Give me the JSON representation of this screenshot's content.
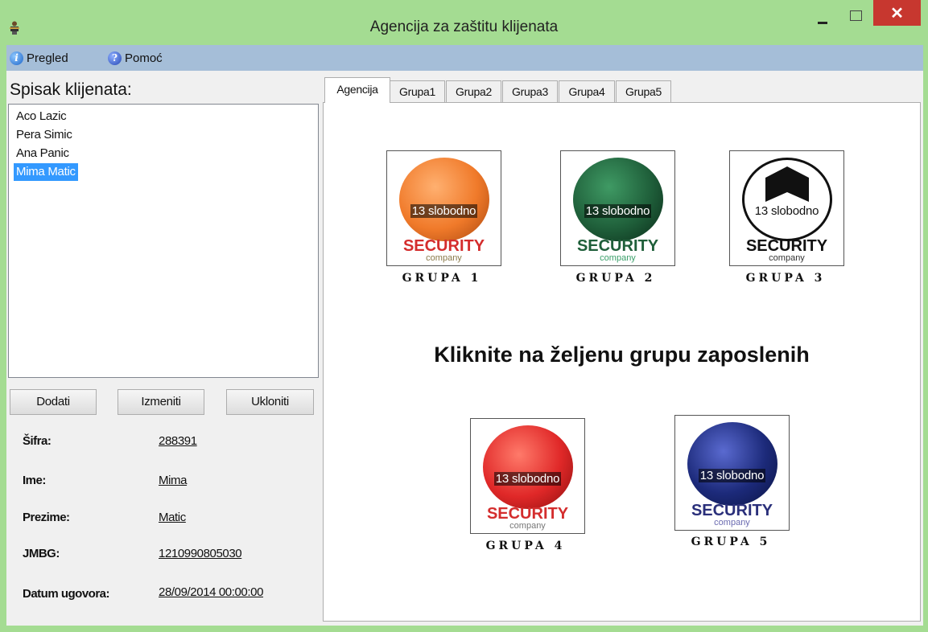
{
  "window": {
    "title": "Agencija za zaštitu klijenata",
    "close_glyph": "✕"
  },
  "menu": [
    {
      "label": "Pregled",
      "icon": "info-icon"
    },
    {
      "label": "Pomoć",
      "icon": "help-icon"
    }
  ],
  "clients": {
    "title": "Spisak klijenata:",
    "items": [
      "Aco Lazic",
      "Pera Simic",
      "Ana Panic",
      "Mima Matic"
    ],
    "selected": "Mima Matic"
  },
  "actions": {
    "add": "Dodati",
    "edit": "Izmeniti",
    "remove": "Ukloniti"
  },
  "details": {
    "sifra_label": "Šifra:",
    "sifra": "288391",
    "ime_label": "Ime:",
    "ime": "Mima",
    "prezime_label": "Prezime:",
    "prezime": "Matic",
    "jmbg_label": "JMBG:",
    "jmbg": "1210990805030",
    "datum_label": "Datum ugovora:",
    "datum": "28/09/2014 00:00:00"
  },
  "tabs": [
    "Agencija",
    "Grupa1",
    "Grupa2",
    "Grupa3",
    "Grupa4",
    "Grupa5"
  ],
  "active_tab": "Agencija",
  "agency": {
    "instruction": "Kliknite na željenu grupu zaposlenih",
    "groups": [
      {
        "label": "GRUPA 1",
        "available": "13 slobodno",
        "logo_text": "SECURITY",
        "logo_sub": "company",
        "color": "#f07a2a"
      },
      {
        "label": "GRUPA 2",
        "available": "13 slobodno",
        "logo_text": "SECURITY",
        "logo_sub": "company",
        "color": "#1f5f3a"
      },
      {
        "label": "GRUPA 3",
        "available": "13 slobodno",
        "logo_text": "SECURITY",
        "logo_sub": "company",
        "color": "#222222"
      },
      {
        "label": "GRUPA 4",
        "available": "13 slobodno",
        "logo_text": "SECURITY",
        "logo_sub": "company",
        "color": "#e02828"
      },
      {
        "label": "GRUPA 5",
        "available": "13 slobodno",
        "logo_text": "SECURITY",
        "logo_sub": "company",
        "color": "#1c2a7a"
      }
    ]
  }
}
